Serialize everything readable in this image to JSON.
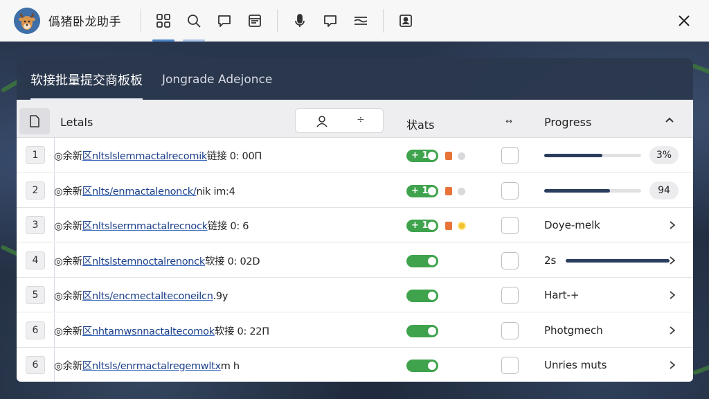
{
  "app": {
    "title": "僞猪卧龙助手"
  },
  "toolbar": {
    "icons": [
      "grid-icon",
      "search-icon",
      "chat-icon",
      "calendar-icon",
      "microphone-icon",
      "message-icon",
      "filter-lines-icon",
      "contact-card-icon"
    ]
  },
  "tabs": [
    {
      "label": "软接批量提交商板板",
      "active": true
    },
    {
      "label": "Jongrade Adejonce",
      "active": false
    }
  ],
  "table": {
    "headers": {
      "details": "Letals",
      "status": "状ats",
      "arrow": "↔",
      "progress": "Progress"
    },
    "rows": [
      {
        "num": "1",
        "prefix": "◎余新",
        "link": "区nltslslemmactalrecomik",
        "suffix": "链接 0: 00Π",
        "toggle_label": "+ 1",
        "show_toggle_label": true,
        "indicators": "orange-gray",
        "progress_type": "bar",
        "progress": 0.6,
        "badge": "3%"
      },
      {
        "num": "2",
        "prefix": "◎余新",
        "link": "区nlts/enmactalenonck/",
        "suffix": "nik im:4",
        "toggle_label": "+ 1",
        "show_toggle_label": true,
        "indicators": "orange-gray",
        "progress_type": "bar",
        "progress": 0.68,
        "badge": "94"
      },
      {
        "num": "3",
        "prefix": "◎余新",
        "link": "区nltslsermmactalrecnock",
        "suffix": "链接 0: 6",
        "toggle_label": "+ 1",
        "show_toggle_label": true,
        "indicators": "orange-yellow",
        "progress_type": "text",
        "text": "Doye-melk"
      },
      {
        "num": "4",
        "prefix": "◎余新",
        "link": "区nltslstemnoctalrenonck",
        "suffix": "软接 0: 02D",
        "toggle_label": "",
        "show_toggle_label": false,
        "indicators": "none",
        "progress_type": "text-bar",
        "text": "2s",
        "progress": 1.0
      },
      {
        "num": "5",
        "prefix": "◎余新",
        "link": "区nlts/encmectalteconeilcn",
        "suffix": ".9y",
        "toggle_label": "",
        "show_toggle_label": false,
        "indicators": "none",
        "progress_type": "text",
        "text": "Hart-+"
      },
      {
        "num": "6",
        "prefix": "◎余新",
        "link": "区nhtamwsnnactaltecomok",
        "suffix": "软接 0: 22Π",
        "toggle_label": "",
        "show_toggle_label": false,
        "indicators": "none",
        "progress_type": "text",
        "text": "Photgmech"
      },
      {
        "num": "6",
        "prefix": "◎余新",
        "link": "区nltsls/enrmactalregemwltx",
        "suffix": "m h",
        "toggle_label": "",
        "show_toggle_label": false,
        "indicators": "none",
        "progress_type": "text",
        "text": "Unries muts"
      }
    ]
  },
  "colors": {
    "accent": "#4c86c6",
    "toggle_on": "#3fa34d",
    "orange": "#e8733a",
    "yellow": "#f2c230",
    "progress_fill": "#2a3d5c"
  }
}
